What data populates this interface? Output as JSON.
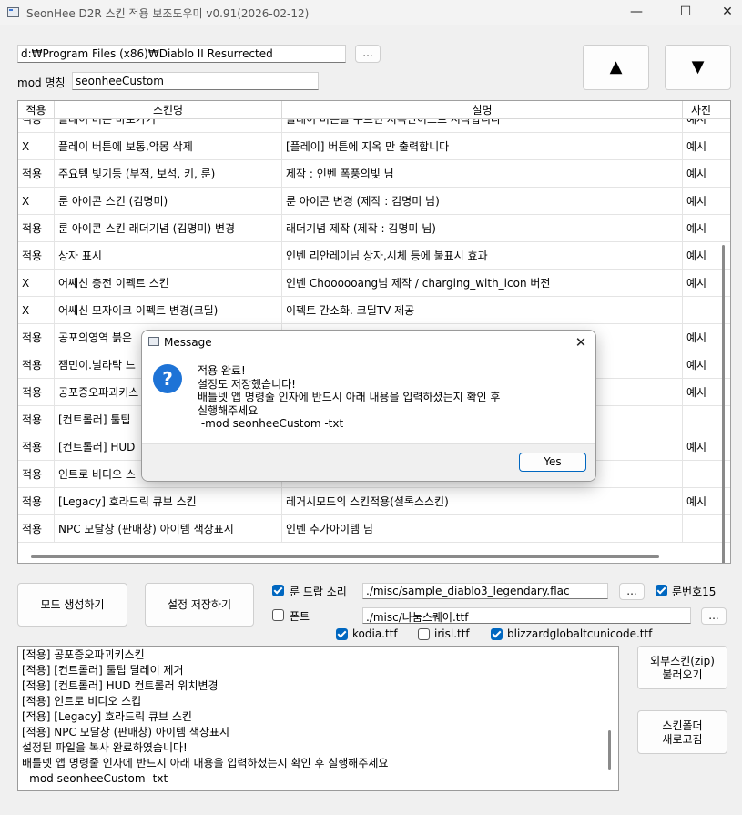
{
  "window": {
    "title": "SeonHee D2R 스킨 적용 보조도우미 v0.91(2026-02-12)",
    "minimize": "—",
    "maximize": "☐",
    "close": "✕"
  },
  "path": {
    "value": "d:₩Program Files (x86)₩Diablo II Resurrected",
    "browse_label": "..."
  },
  "mod": {
    "label": "mod 명칭",
    "value": "seonheeCustom"
  },
  "nav": {
    "up": "▲",
    "down": "▼"
  },
  "table": {
    "headers": [
      "적용",
      "스킨명",
      "설명",
      "사진"
    ],
    "rows": [
      {
        "apply": "적용",
        "name": "플레이 버튼 바로가기",
        "desc": "플레이 버튼을 누르면 지옥난이도로 시작합니다",
        "photo": "예시"
      },
      {
        "apply": "X",
        "name": "플레이 버튼에 보통,악몽 삭제",
        "desc": "[플레이] 버튼에 지옥 만 출력합니다",
        "photo": "예시"
      },
      {
        "apply": "적용",
        "name": "주요템 빛기둥 (부적, 보석, 키, 룬)",
        "desc": "제작 : 인벤 폭풍의빛 님",
        "photo": "예시"
      },
      {
        "apply": "X",
        "name": "룬 아이콘 스킨 (김명미)",
        "desc": "룬 아이콘 변경 (제작 : 김명미 님)",
        "photo": "예시"
      },
      {
        "apply": "적용",
        "name": "룬 아이콘 스킨 래더기념 (김명미) 변경",
        "desc": "래더기념 제작 (제작 : 김명미 님)",
        "photo": "예시"
      },
      {
        "apply": "적용",
        "name": "상자 표시",
        "desc": "인벤 리안레이님 상자,시체 등에 불표시 효과",
        "photo": "예시"
      },
      {
        "apply": "X",
        "name": "어쌔신 충전 이펙트 스킨",
        "desc": "인벤 Choooooang님 제작 / charging_with_icon 버전",
        "photo": "예시"
      },
      {
        "apply": "X",
        "name": "어쌔신 모자이크 이펙트 변경(크딜)",
        "desc": "이펙트 간소화. 크딜TV 제공",
        "photo": ""
      },
      {
        "apply": "적용",
        "name": "공포의영역 붉은",
        "desc": "",
        "photo": "예시"
      },
      {
        "apply": "적용",
        "name": "잼민이.닐라탁 느",
        "desc": "",
        "photo": "예시"
      },
      {
        "apply": "적용",
        "name": "공포증오파괴키스",
        "desc": "",
        "photo": "예시"
      },
      {
        "apply": "적용",
        "name": "[컨트롤러] 툴팁",
        "desc": "",
        "photo": ""
      },
      {
        "apply": "적용",
        "name": "[컨트롤러] HUD",
        "desc": "",
        "photo": "예시"
      },
      {
        "apply": "적용",
        "name": "인트로 비디오 스",
        "desc": "",
        "photo": ""
      },
      {
        "apply": "적용",
        "name": "[Legacy] 호라드릭 큐브 스킨",
        "desc": "레거시모드의 스킨적용(셜록스스킨)",
        "photo": "예시"
      },
      {
        "apply": "적용",
        "name": "NPC 모달창 (판매창) 아이템 색상표시",
        "desc": "인벤 추가아이템 님",
        "photo": ""
      }
    ]
  },
  "buttons": {
    "mod_create": "모드 생성하기",
    "save_settings": "설정 저장하기",
    "external_skin": "외부스킨(zip)\n불러오기",
    "refresh_folder": "스킨폴더\n새로고침"
  },
  "options": {
    "rune_sound": {
      "label": "룬 드랍 소리",
      "checked": true,
      "value": "./misc/sample_diablo3_legendary.flac"
    },
    "rune_number": {
      "label": "룬번호15",
      "checked": true
    },
    "font": {
      "label": "폰트",
      "checked": false,
      "value": "./misc/나눔스퀘어.ttf"
    },
    "font_files": [
      {
        "label": "kodia.ttf",
        "checked": true
      },
      {
        "label": "irisl.ttf",
        "checked": false
      },
      {
        "label": "blizzardglobaltcunicode.ttf",
        "checked": true
      }
    ],
    "browse_label": "..."
  },
  "log": [
    "[적용] 공포증오파괴키스킨",
    "[적용] [컨트롤러] 툴팁 딜레이 제거",
    "[적용] [컨트롤러] HUD 컨트롤러 위치변경",
    "[적용] 인트로 비디오 스킵",
    "[적용] [Legacy] 호라드릭 큐브 스킨",
    "[적용] NPC 모달창 (판매창) 아이템 색상표시",
    "설정된 파일을 복사 완료하였습니다!",
    "배틀넷 앱 명령줄 인자에 반드시 아래 내용을 입력하셨는지 확인 후 실행해주세요",
    " -mod seonheeCustom -txt"
  ],
  "dialog": {
    "title": "Message",
    "close": "✕",
    "icon": "?",
    "message": "적용 완료!\n설정도 저장했습니다!\n배틀넷 앱 명령줄 인자에 반드시 아래 내용을 입력하셨는지 확인 후\n실행해주세요\n -mod seonheeCustom -txt",
    "yes_label": "Yes"
  }
}
